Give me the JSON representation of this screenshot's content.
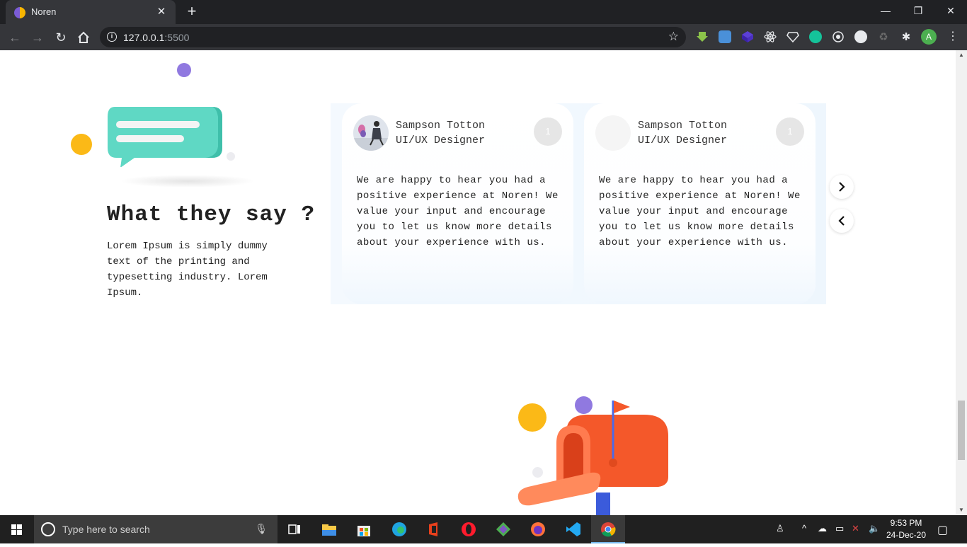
{
  "browser": {
    "tab_title": "Noren",
    "close_tab": "✕",
    "new_tab": "+",
    "url_host": "127.0.0.1",
    "url_port": ":5500",
    "profile_initial": "A",
    "window_minimize": "—",
    "window_restore": "❐",
    "window_close": "✕"
  },
  "testimonials": {
    "heading": "What they say ?",
    "description": "Lorem Ipsum is simply dummy text of the printing and typesetting industry. Lorem Ipsum.",
    "cards": [
      {
        "name": "Sampson Totton",
        "role": "UI/UX Designer",
        "badge": "1",
        "quote": "We are happy to hear you had a positive experience at Noren! We value your input and encourage you to let us know more details about your experience with us."
      },
      {
        "name": "Sampson Totton",
        "role": "UI/UX Designer",
        "badge": "1",
        "quote": "We are happy to hear you had a positive experience at Noren! We value your input and encourage you to let us know more details about your experience with us."
      }
    ],
    "next_arrow": "›",
    "prev_arrow": "‹"
  },
  "taskbar": {
    "search_placeholder": "Type here to search",
    "time": "9:53 PM",
    "date": "24-Dec-20"
  },
  "colors": {
    "chrome_dark": "#202124",
    "chrome_toolbar": "#35363a",
    "accent_yellow": "#fbb917",
    "accent_purple": "#9079e0",
    "bubble_teal": "#5fd8c4",
    "mailbox_orange": "#f4582a",
    "taskbar": "#202020"
  }
}
